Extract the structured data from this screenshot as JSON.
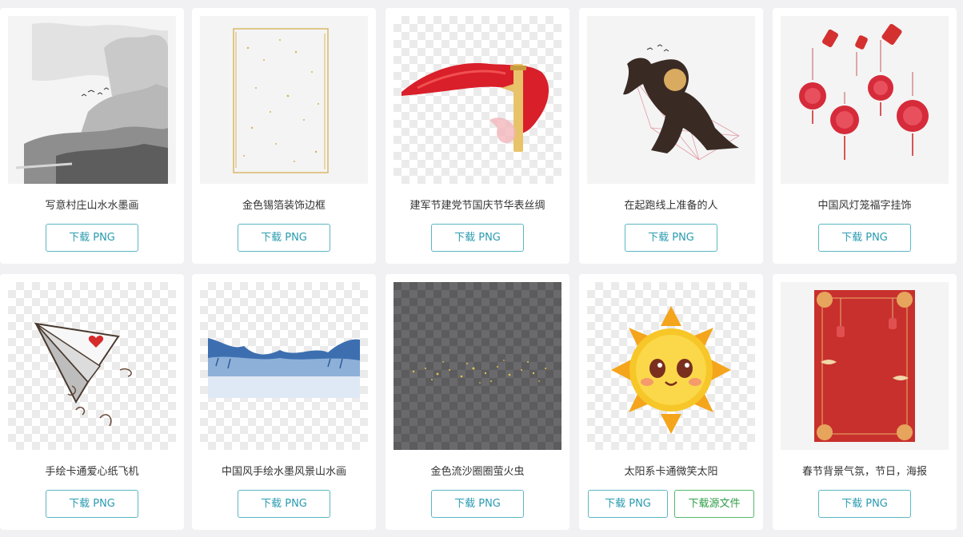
{
  "items": [
    {
      "title": "写意村庄山水水墨画",
      "button": "下载 PNG",
      "image": "ink-landscape-village"
    },
    {
      "title": "金色锡箔装饰边框",
      "button": "下载 PNG",
      "image": "gold-foil-frame"
    },
    {
      "title": "建军节建党节国庆节华表丝绸",
      "button": "下载 PNG",
      "image": "red-silk-pillar"
    },
    {
      "title": "在起跑线上准备的人",
      "button": "下载 PNG",
      "image": "sprinter-silhouette"
    },
    {
      "title": "中国风灯笼福字挂饰",
      "button": "下载 PNG",
      "image": "red-lanterns-fu"
    },
    {
      "title": "手绘卡通爱心纸飞机",
      "button": "下载 PNG",
      "image": "paper-plane-heart"
    },
    {
      "title": "中国风手绘水墨风景山水画",
      "button": "下载 PNG",
      "image": "blue-ink-landscape"
    },
    {
      "title": "金色流沙圈圈萤火虫",
      "button": "下载 PNG",
      "image": "gold-sparkles"
    },
    {
      "title": "太阳系卡通微笑太阳",
      "button": "下载 PNG",
      "button2": "下载源文件",
      "image": "cartoon-sun"
    },
    {
      "title": "春节背景气氛，节日，海报",
      "button": "下载 PNG",
      "image": "spring-festival-poster"
    }
  ],
  "colors": {
    "accent": "#2a9bb0",
    "source_file": "#2f9e46",
    "festival_red": "#d83a3a"
  }
}
